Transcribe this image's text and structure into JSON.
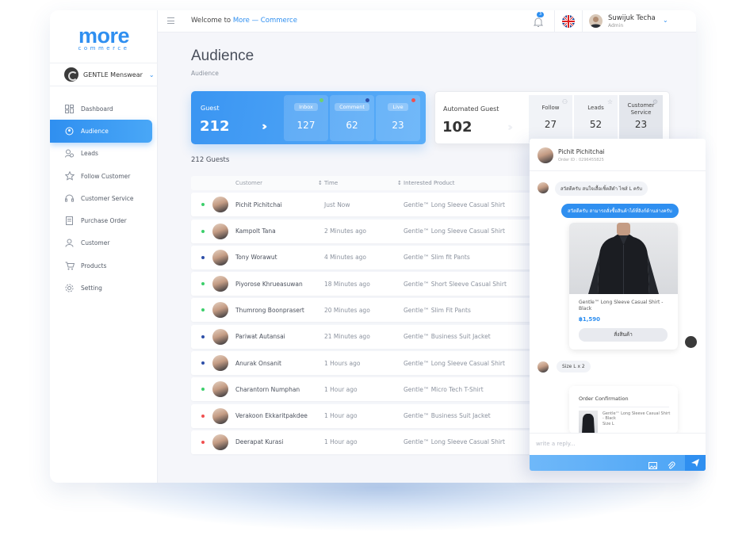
{
  "logo": {
    "big": "more",
    "small": "commerce"
  },
  "store": {
    "name": "GENTLE Menswear"
  },
  "nav": [
    {
      "label": "Dashboard",
      "icon": "dashboard-icon"
    },
    {
      "label": "Audience",
      "icon": "audience-icon"
    },
    {
      "label": "Leads",
      "icon": "leads-icon"
    },
    {
      "label": "Follow Customer",
      "icon": "star-icon"
    },
    {
      "label": "Customer Service",
      "icon": "headset-icon"
    },
    {
      "label": "Purchase Order",
      "icon": "receipt-icon"
    },
    {
      "label": "Customer",
      "icon": "user-icon"
    },
    {
      "label": "Products",
      "icon": "cart-icon"
    },
    {
      "label": "Setting",
      "icon": "gear-icon"
    }
  ],
  "topbar": {
    "welcome_prefix": "Welcome to",
    "welcome_brand": "More — Commerce",
    "notifications": "3",
    "user_name": "Suwijuk Techa",
    "user_role": "Admin"
  },
  "page": {
    "title": "Audience",
    "breadcrumb": "Audience"
  },
  "guest_card": {
    "label": "Guest",
    "total": "212",
    "subs": [
      {
        "label": "Inbox",
        "value": "127",
        "dot": "#6fd16f"
      },
      {
        "label": "Comment",
        "value": "62",
        "dot": "#2e4fa8"
      },
      {
        "label": "Live",
        "value": "23",
        "dot": "#f05050"
      }
    ]
  },
  "auto_card": {
    "label": "Automated Guest",
    "total": "102",
    "subs": [
      {
        "label": "Follow",
        "value": "27"
      },
      {
        "label": "Leads",
        "value": "52"
      },
      {
        "label": "Customer Service",
        "value": "23"
      }
    ]
  },
  "guests_count": "212 Guests",
  "table": {
    "headers": [
      "Customer",
      "Time",
      "Interested Product"
    ],
    "rows": [
      {
        "name": "Pichit Pichitchai",
        "time": "Just Now",
        "product": "Gentle™ Long Sleeve Casual Shirt",
        "dot": "#3ccf6b"
      },
      {
        "name": "Kampolt Tana",
        "time": "2 Minutes ago",
        "product": "Gentle™ Long Sleeve Casual Shirt",
        "dot": "#3ccf6b"
      },
      {
        "name": "Tony Worawut",
        "time": "4 Minutes ago",
        "product": "Gentle™ Slim fit Pants",
        "dot": "#2e4fa8"
      },
      {
        "name": "Piyorose Khrueasuwan",
        "time": "18 Minutes ago",
        "product": "Gentle™ Short Sleeve Casual Shirt",
        "dot": "#3ccf6b"
      },
      {
        "name": "Thumrong Boonprasert",
        "time": "20 Minutes ago",
        "product": "Gentle™ Slim Fit Pants",
        "dot": "#3ccf6b"
      },
      {
        "name": "Pariwat Autansai",
        "time": "21 Minutes ago",
        "product": "Gentle™ Business Suit Jacket",
        "dot": "#2e4fa8"
      },
      {
        "name": "Anurak  Onsanit",
        "time": "1 Hours ago",
        "product": "Gentle™ Long Sleeve Casual Shirt",
        "dot": "#2e4fa8"
      },
      {
        "name": "Charantorn Numphan",
        "time": "1 Hour ago",
        "product": "Gentle™ Micro Tech T-Shirt",
        "dot": "#3ccf6b"
      },
      {
        "name": "Verakoon Ekkaritpakdee",
        "time": "1 Hour ago",
        "product": "Gentle™ Business Suit Jacket",
        "dot": "#f05050"
      },
      {
        "name": "Deerapat Kurasi",
        "time": "1 Hour ago",
        "product": "Gentle™ Long Sleeve Casual Shirt",
        "dot": "#f05050"
      }
    ]
  },
  "chat": {
    "name": "Pichit Pichitchai",
    "order_id": "Order ID : 0296455825",
    "msg1": "สวัสดีครับ สนใจเสื้อเชิ้ตสีดำ ไซส์ L ครับ",
    "msg2": "สวัสดีครับ สามารถสั่งซื้อสินค้าได้ที่ลิงก์ด้านล่างครับ",
    "product_name": "Gentle™ Long Sleeve Casual Shirt - Black",
    "product_price": "฿1,590",
    "buy_label": "สั่งสินค้า",
    "msg3": "Size L x 2",
    "order_title": "Order Confirmation",
    "order_item": "Gentle™ Long Sleeve Casual Shirt - Black",
    "order_size": "Size L",
    "reply_placeholder": "write a reply..."
  }
}
